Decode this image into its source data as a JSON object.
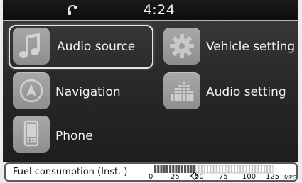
{
  "status_bar": {
    "time": "4:24",
    "status_icon": "phone-handset-icon"
  },
  "menu": {
    "items": [
      {
        "label": "Audio source",
        "icon": "music-note-icon",
        "selected": true
      },
      {
        "label": "Vehicle setting",
        "icon": "gear-icon",
        "selected": false
      },
      {
        "label": "Navigation",
        "icon": "compass-arrow-icon",
        "selected": false
      },
      {
        "label": "Audio setting",
        "icon": "equalizer-icon",
        "selected": false
      },
      {
        "label": "Phone",
        "icon": "mobile-phone-icon",
        "selected": false
      }
    ]
  },
  "fuel": {
    "label": "Fuel consumption (Inst. )",
    "scale": [
      "0",
      "25",
      "50",
      "75",
      "100",
      "125"
    ],
    "unit": "MPG",
    "level_fraction": 0.36
  },
  "colors": {
    "screen_bg": "#2a2a2a",
    "icon_tile": "#9a9a9a",
    "label_text": "#f4f4f4",
    "gauge_fill": "#555555"
  }
}
